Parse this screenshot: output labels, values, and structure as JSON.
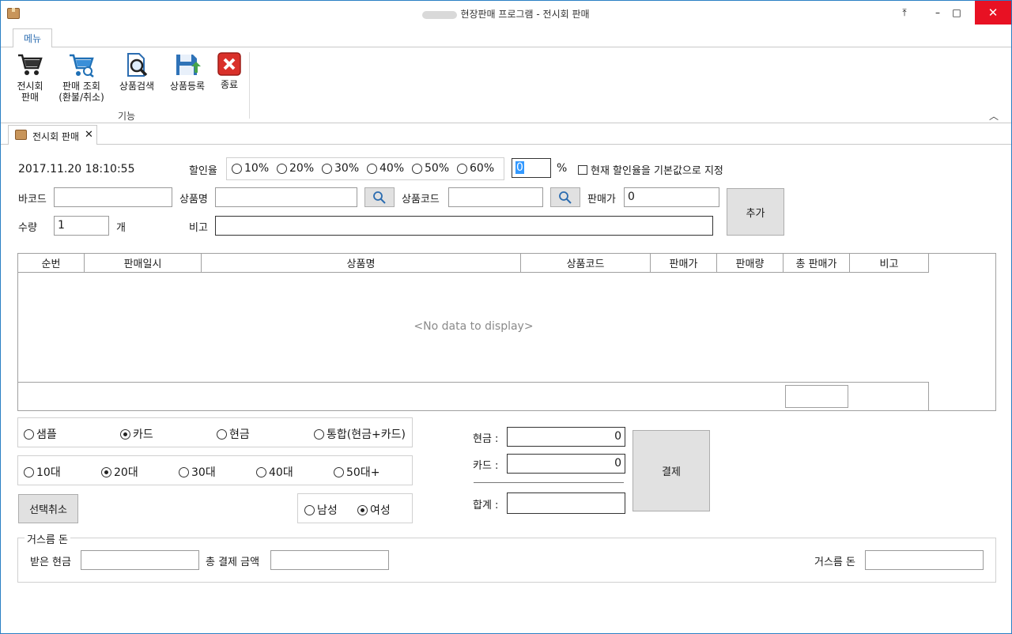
{
  "window": {
    "title": "현장판매 프로그램 - 전시회 판매",
    "buttons": {
      "restore": "⤒",
      "minimize": "–",
      "maximize": "□",
      "close": "✕"
    }
  },
  "ribbon": {
    "tab_label": "메뉴",
    "items": [
      {
        "label": "전시회\n판매",
        "icon": "shopping-cart-icon"
      },
      {
        "label": "판매 조회\n(환불/취소)",
        "icon": "cart-search-icon"
      },
      {
        "label": "상품검색",
        "icon": "document-search-icon"
      },
      {
        "label": "상품등록",
        "icon": "save-upload-icon"
      },
      {
        "label": "종료",
        "icon": "close-red-icon"
      }
    ],
    "group_label": "기능",
    "collapse_glyph": "︿"
  },
  "doc_tab": {
    "label": "전시회 판매",
    "close": "✕"
  },
  "form": {
    "datetime": "2017.11.20 18:10:55",
    "discount_label": "할인율",
    "discount_options": [
      "10%",
      "20%",
      "30%",
      "40%",
      "50%",
      "60%"
    ],
    "discount_value": "0",
    "percent_sign": "%",
    "default_checkbox_label": "현재 할인율을 기본값으로 지정",
    "barcode_label": "바코드",
    "barcode_value": "",
    "product_name_label": "상품명",
    "product_name_value": "",
    "product_code_label": "상품코드",
    "product_code_value": "",
    "price_label": "판매가",
    "price_value": "0",
    "add_button": "추가",
    "qty_label": "수량",
    "qty_value": "1",
    "qty_unit": "개",
    "note_label": "비고",
    "note_value": ""
  },
  "grid": {
    "columns": [
      "순번",
      "판매일시",
      "상품명",
      "상품코드",
      "판매가",
      "판매량",
      "총 판매가",
      "비고"
    ],
    "empty_text": "<No data to display>"
  },
  "payment_type": {
    "options": [
      "샘플",
      "카드",
      "현금",
      "통합(현금+카드)"
    ],
    "selected": 1
  },
  "age_group": {
    "options": [
      "10대",
      "20대",
      "30대",
      "40대",
      "50대+"
    ],
    "selected": 1
  },
  "gender": {
    "options": [
      "남성",
      "여성"
    ],
    "selected": 1
  },
  "deselect_button": "선택취소",
  "totals": {
    "cash_label": "현금 :",
    "cash_value": "0",
    "card_label": "카드 :",
    "card_value": "0",
    "sum_label": "합계 :",
    "sum_value": "",
    "pay_button": "결제"
  },
  "change": {
    "group_title": "거스름 돈",
    "received_label": "받은 현금",
    "received_value": "",
    "total_label": "총 결제 금액",
    "total_value": "",
    "change_label": "거스름 돈",
    "change_value": ""
  }
}
